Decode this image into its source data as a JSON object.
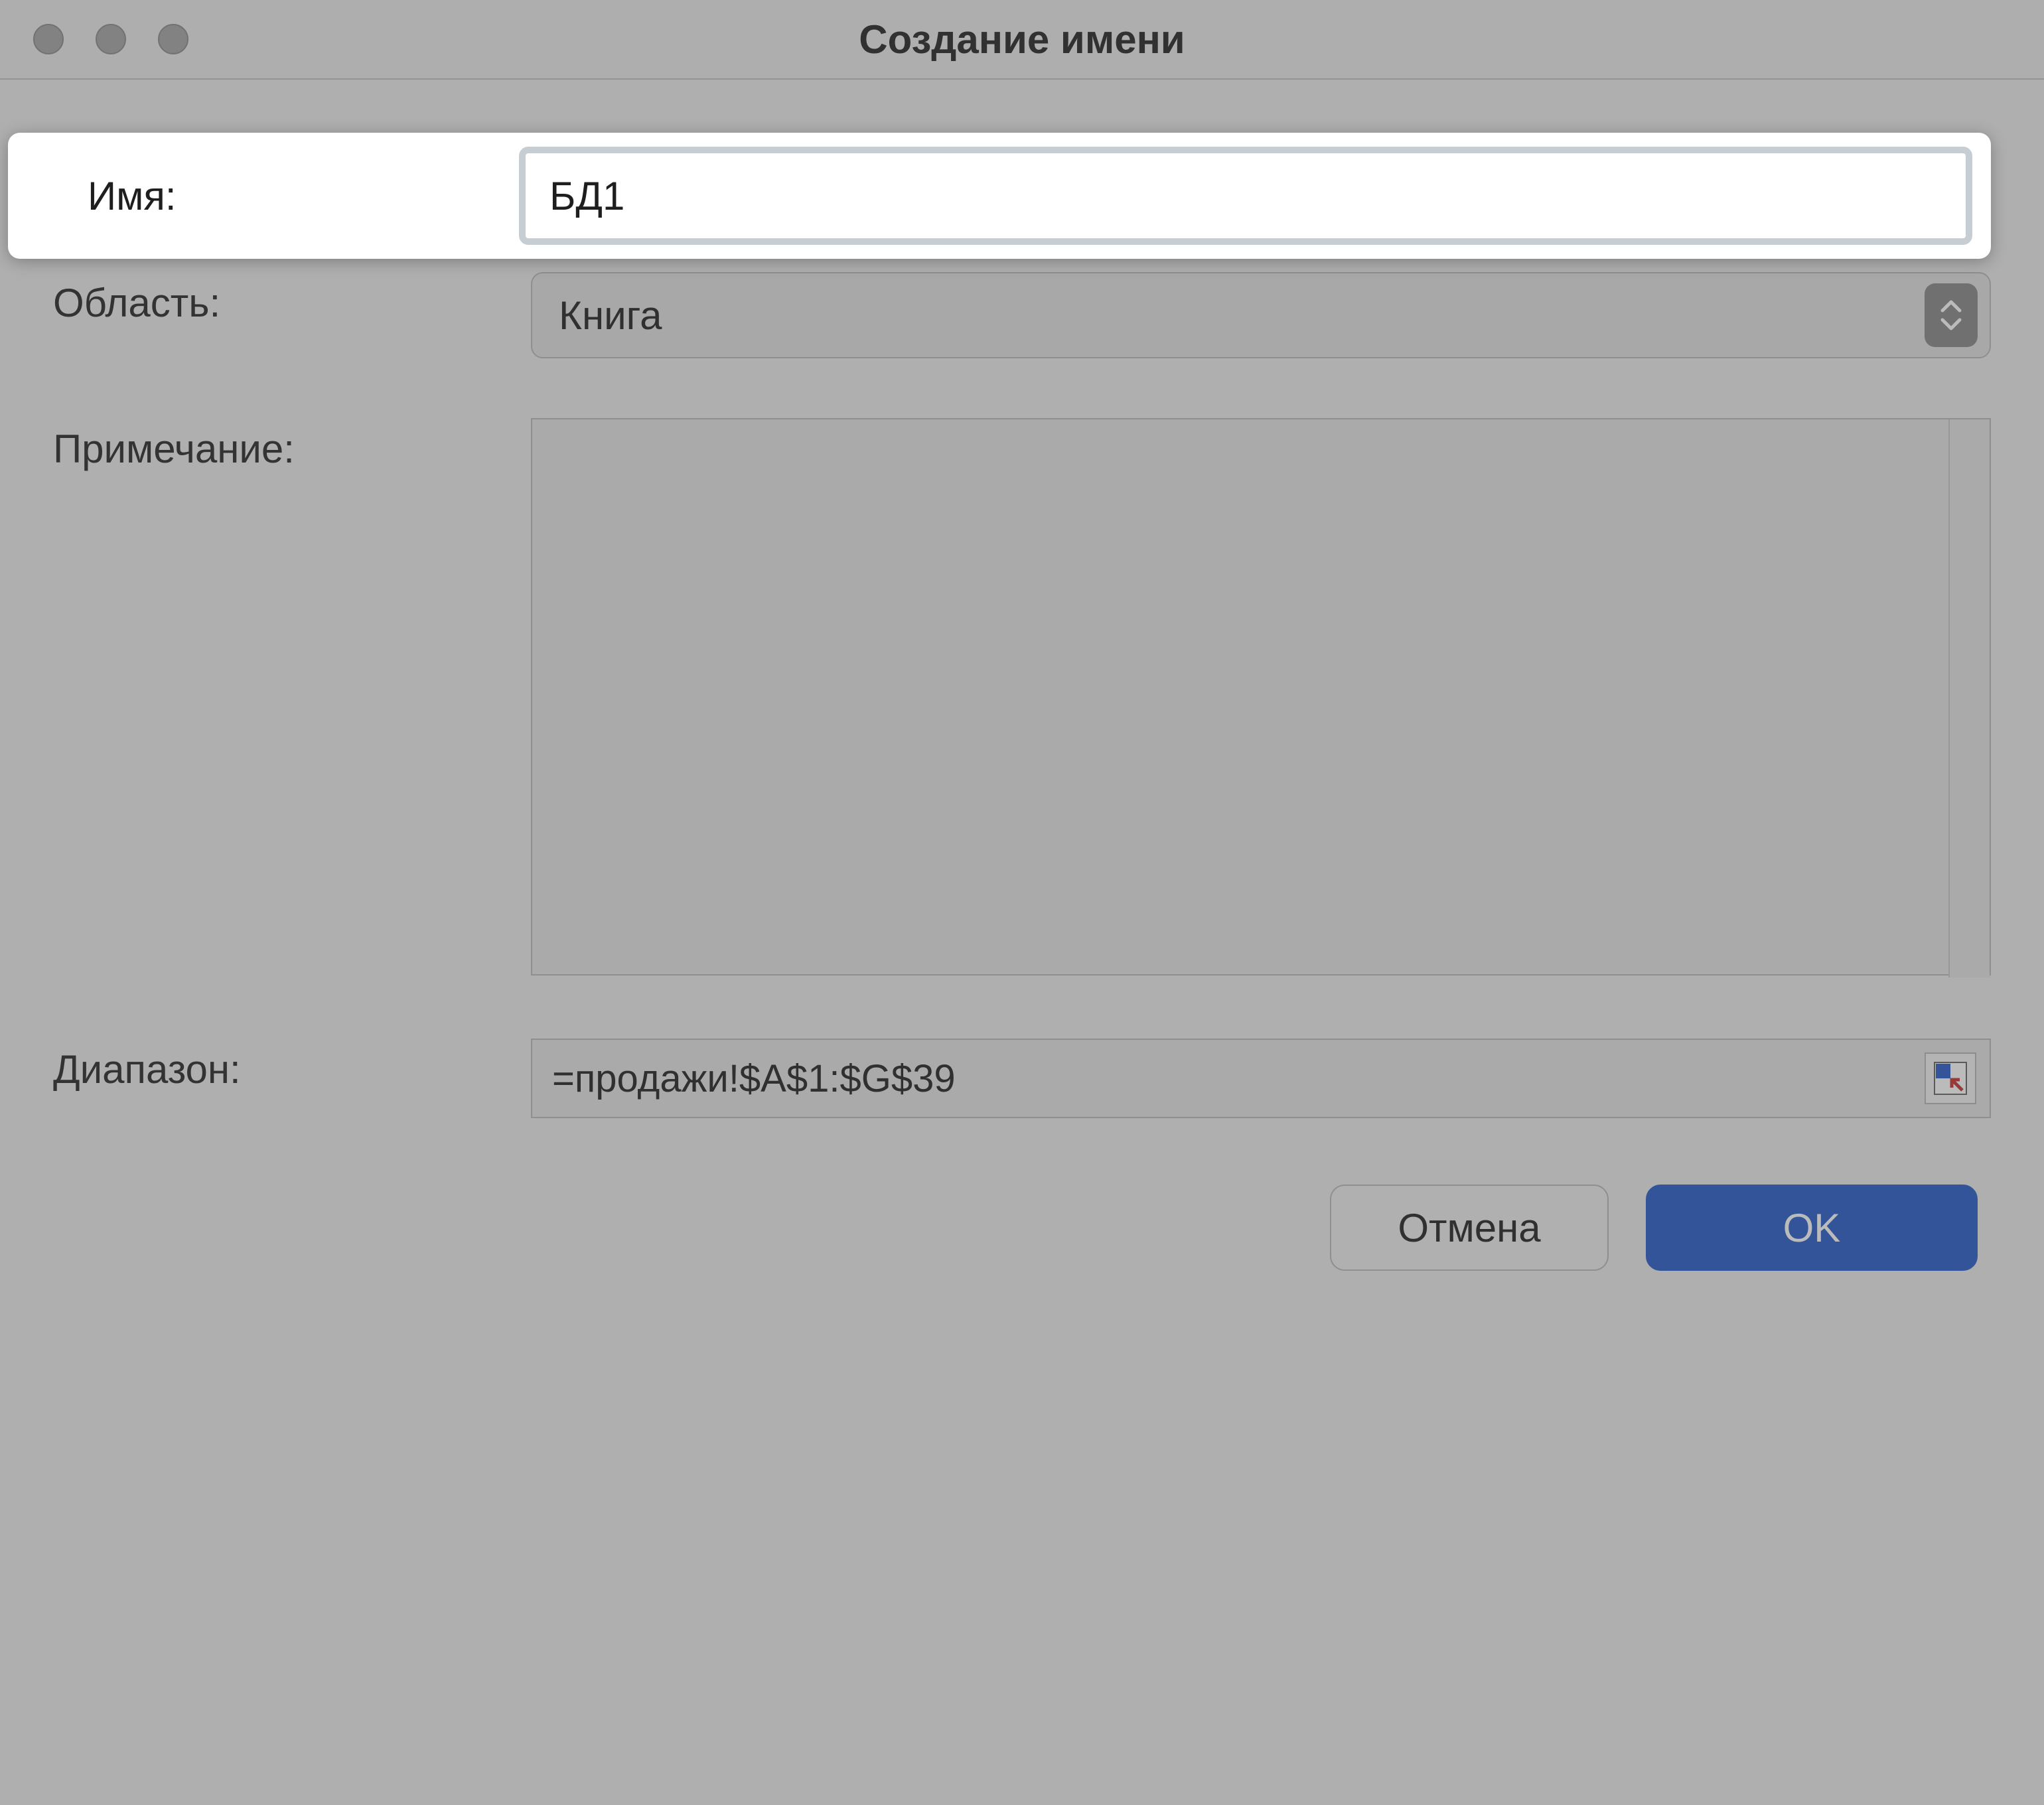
{
  "window": {
    "title": "Создание имени"
  },
  "fields": {
    "name": {
      "label": "Имя:",
      "value": "БД1"
    },
    "scope": {
      "label": "Область:",
      "value": "Книга"
    },
    "comment": {
      "label": "Примечание:",
      "value": ""
    },
    "range": {
      "label": "Диапазон:",
      "value": "=продажи!$A$1:$G$39"
    }
  },
  "footer": {
    "cancel": "Отмена",
    "ok": "OK"
  }
}
